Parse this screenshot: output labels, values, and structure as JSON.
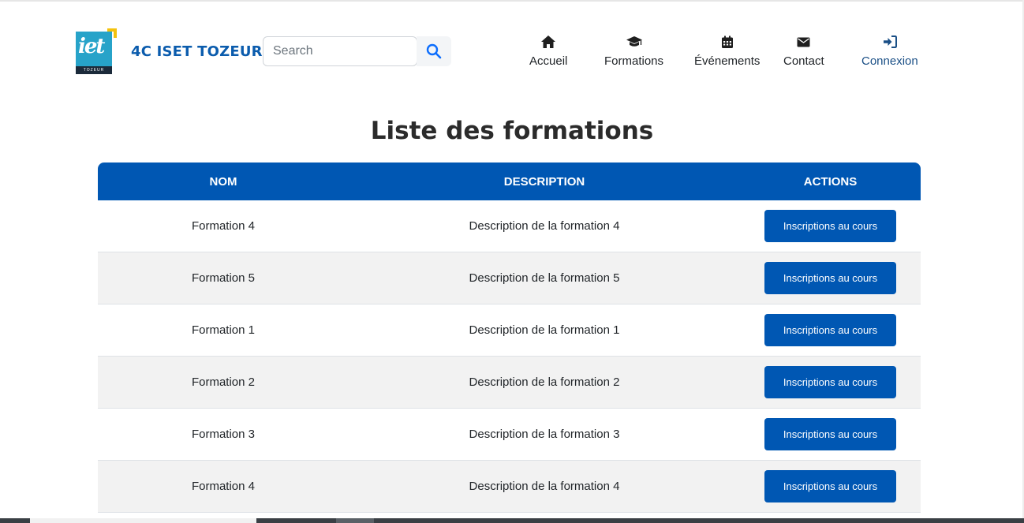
{
  "brand": {
    "name": "4C ISET TOZEUR",
    "logo_text": "iet",
    "logo_band": "TOZEUR"
  },
  "search": {
    "placeholder": "Search",
    "value": ""
  },
  "nav": {
    "items": [
      {
        "label": "Accueil",
        "icon": "home-icon"
      },
      {
        "label": "Formations",
        "icon": "graduation-cap-icon"
      },
      {
        "label": "Événements",
        "icon": "calendar-icon"
      },
      {
        "label": "Contact",
        "icon": "envelope-icon"
      },
      {
        "label": "Connexion",
        "icon": "sign-in-icon"
      }
    ]
  },
  "page": {
    "title": "Liste des formations"
  },
  "table": {
    "headers": {
      "nom": "NOM",
      "description": "DESCRIPTION",
      "actions": "ACTIONS"
    },
    "rows": [
      {
        "nom": "Formation 4",
        "description": "Description de la formation 4",
        "action": "Inscriptions au cours"
      },
      {
        "nom": "Formation 5",
        "description": "Description de la formation 5",
        "action": "Inscriptions au cours"
      },
      {
        "nom": "Formation 1",
        "description": "Description de la formation 1",
        "action": "Inscriptions au cours"
      },
      {
        "nom": "Formation 2",
        "description": "Description de la formation 2",
        "action": "Inscriptions au cours"
      },
      {
        "nom": "Formation 3",
        "description": "Description de la formation 3",
        "action": "Inscriptions au cours"
      },
      {
        "nom": "Formation 4",
        "description": "Description de la formation 4",
        "action": "Inscriptions au cours"
      }
    ]
  },
  "colors": {
    "primary": "#0057b3",
    "brand_text": "#0b5cad",
    "logo_blue": "#27a3c9",
    "logo_yellow": "#f4c20d",
    "stripe": "#f2f2f2"
  }
}
